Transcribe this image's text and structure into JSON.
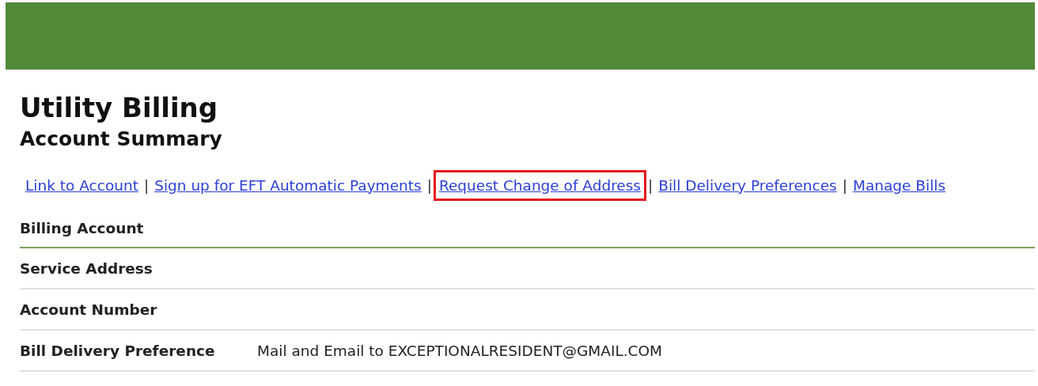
{
  "header": {
    "kind": "banner"
  },
  "title": "Utility Billing",
  "subtitle": "Account Summary",
  "links": [
    {
      "label": "Link to Account",
      "highlighted": false
    },
    {
      "label": "Sign up for EFT Automatic Payments",
      "highlighted": false,
      "separator_before": "|"
    },
    {
      "label": "Request Change of Address",
      "highlighted": true,
      "separator_before": "|"
    },
    {
      "label": "Bill Delivery Preferences",
      "highlighted": false,
      "separator_before": "|"
    },
    {
      "label": "Manage Bills",
      "highlighted": false,
      "separator_before": "|"
    }
  ],
  "rows": [
    {
      "kind": "heading",
      "label": "Billing Account"
    },
    {
      "kind": "field",
      "label": "Service Address"
    },
    {
      "kind": "field",
      "label": "Account Number"
    },
    {
      "kind": "field",
      "label": "Bill Delivery Preference",
      "value": "Mail and Email to EXCEPTIONALRESIDENT@GMAIL.COM"
    }
  ]
}
